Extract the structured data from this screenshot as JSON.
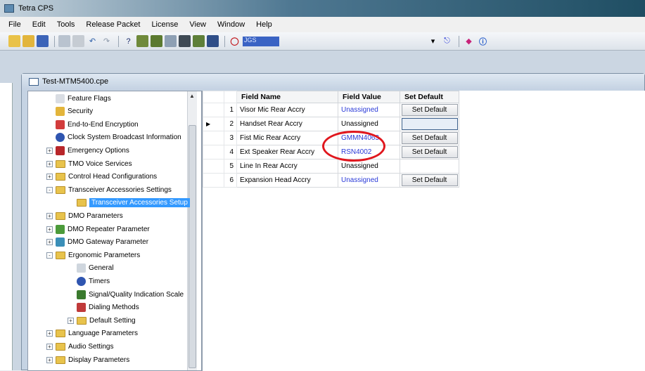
{
  "app": {
    "title": "Tetra CPS"
  },
  "menu": [
    "File",
    "Edit",
    "Tools",
    "Release Packet",
    "License",
    "View",
    "Window",
    "Help"
  ],
  "toolbar": {
    "field_value": "JGS"
  },
  "child_window": {
    "title": "Test-MTM5400.cpe"
  },
  "tree": [
    {
      "label": "Feature Flags",
      "indent": 1,
      "icon": "feature-flags-icon",
      "expander": ""
    },
    {
      "label": "Security",
      "indent": 1,
      "icon": "key-icon",
      "expander": ""
    },
    {
      "label": "End-to-End Encryption",
      "indent": 1,
      "icon": "encryption-icon",
      "expander": ""
    },
    {
      "label": "Clock System Broadcast Information",
      "indent": 1,
      "icon": "clock-icon",
      "expander": ""
    },
    {
      "label": "Emergency Options",
      "indent": 1,
      "icon": "emergency-icon",
      "expander": "+"
    },
    {
      "label": "TMO Voice Services",
      "indent": 1,
      "icon": "folder-icon",
      "expander": "+"
    },
    {
      "label": "Control Head Configurations",
      "indent": 1,
      "icon": "folder-icon",
      "expander": "+"
    },
    {
      "label": "Transceiver Accessories Settings",
      "indent": 1,
      "icon": "folder-icon",
      "expander": "-"
    },
    {
      "label": "Transceiver Accessories Setup",
      "indent": 2,
      "icon": "folder-icon",
      "expander": "",
      "selected": true
    },
    {
      "label": "DMO Parameters",
      "indent": 1,
      "icon": "folder-icon",
      "expander": "+"
    },
    {
      "label": "DMO Repeater Parameter",
      "indent": 1,
      "icon": "dmo-repeater-icon",
      "expander": "+"
    },
    {
      "label": "DMO Gateway Parameter",
      "indent": 1,
      "icon": "dmo-gateway-icon",
      "expander": "+"
    },
    {
      "label": "Ergonomic Parameters",
      "indent": 1,
      "icon": "folder-icon",
      "expander": "-"
    },
    {
      "label": "General",
      "indent": 2,
      "icon": "general-icon",
      "expander": ""
    },
    {
      "label": "Timers",
      "indent": 2,
      "icon": "timer-icon",
      "expander": ""
    },
    {
      "label": "Signal/Quality Indication Scale",
      "indent": 2,
      "icon": "signal-icon",
      "expander": ""
    },
    {
      "label": "Dialing Methods",
      "indent": 2,
      "icon": "dialing-icon",
      "expander": ""
    },
    {
      "label": "Default Setting",
      "indent": 2,
      "icon": "folder-icon",
      "expander": "+"
    },
    {
      "label": "Language Parameters",
      "indent": 1,
      "icon": "folder-icon",
      "expander": "+"
    },
    {
      "label": "Audio Settings",
      "indent": 1,
      "icon": "folder-icon",
      "expander": "+"
    },
    {
      "label": "Display Parameters",
      "indent": 1,
      "icon": "folder-icon",
      "expander": "+"
    }
  ],
  "grid": {
    "headers": [
      "Field Name",
      "Field Value",
      "Set Default"
    ],
    "rows": [
      {
        "index": "1",
        "name": "Visor Mic Rear Accry",
        "value": "Unassigned",
        "value_blue": true,
        "button": "Set Default"
      },
      {
        "index": "2",
        "name": "Handset Rear Accry",
        "value": "Unassigned",
        "value_blue": false,
        "button": "",
        "current": true
      },
      {
        "index": "3",
        "name": "Fist Mic Rear Accry",
        "value": "GMMN4063",
        "value_blue": true,
        "button": "Set Default"
      },
      {
        "index": "4",
        "name": "Ext Speaker Rear Accry",
        "value": "RSN4002",
        "value_blue": true,
        "button": "Set Default"
      },
      {
        "index": "5",
        "name": "Line In Rear Accry",
        "value": "Unassigned",
        "value_blue": false,
        "button": ""
      },
      {
        "index": "6",
        "name": "Expansion Head Accry",
        "value": "Unassigned",
        "value_blue": true,
        "button": "Set Default"
      }
    ]
  },
  "colors": {
    "highlight_oval": "#e0161d",
    "selection": "#3399ff",
    "link_value": "#2a3ad8"
  }
}
